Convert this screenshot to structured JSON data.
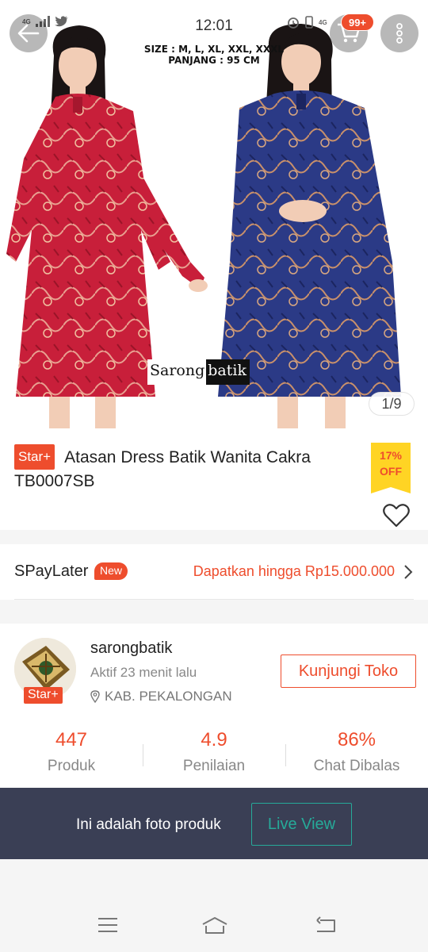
{
  "status_bar": {
    "time": "12:01",
    "network_left": "4G",
    "network_right": "4G"
  },
  "header": {
    "cart_badge": "99+"
  },
  "hero": {
    "size_line": "SIZE : M, L, XL, XXL, XXXL",
    "length_line": "PANJANG : 95 CM",
    "brand_part1": "Sarong",
    "brand_part2": "batik",
    "page_indicator": "1/9",
    "dress_colors": {
      "left": "#c81f3a",
      "right": "#2b3a86"
    }
  },
  "product": {
    "badge": "Star+",
    "title": "Atasan Dress Batik Wanita Cakra TB0007SB",
    "discount_percent": "17%",
    "discount_off": "OFF"
  },
  "spaylater": {
    "label": "SPayLater",
    "new_badge": "New",
    "promo": "Dapatkan hingga Rp15.000.000"
  },
  "shop": {
    "name": "sarongbatik",
    "active": "Aktif 23 menit lalu",
    "location": "KAB. PEKALONGAN",
    "badge": "Star+",
    "visit_button": "Kunjungi Toko",
    "stats": [
      {
        "value": "447",
        "label": "Produk"
      },
      {
        "value": "4.9",
        "label": "Penilaian"
      },
      {
        "value": "86%",
        "label": "Chat Dibalas"
      }
    ]
  },
  "banner": {
    "text": "Ini adalah foto produk",
    "button": "Live View"
  },
  "colors": {
    "accent": "#ee4d2d",
    "discount_bg": "#ffd424",
    "banner_bg": "#3a3f55",
    "live_view": "#26aa99"
  }
}
